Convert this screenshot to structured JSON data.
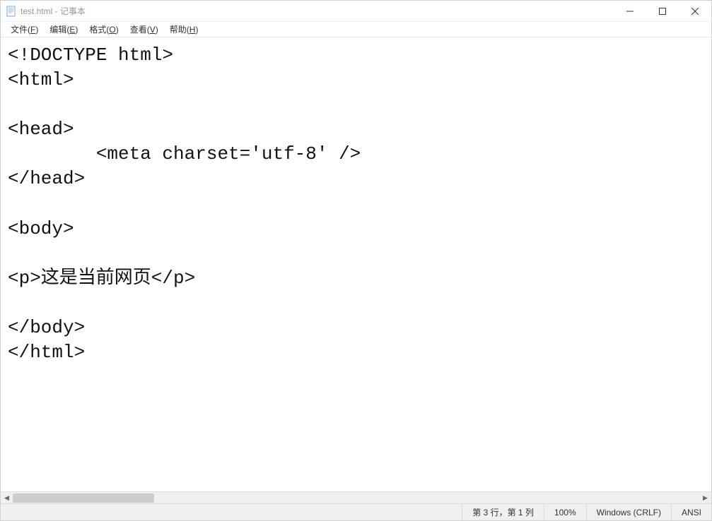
{
  "title": "test.html - 记事本",
  "menu": {
    "file": {
      "label": "文件",
      "accel": "F"
    },
    "edit": {
      "label": "编辑",
      "accel": "E"
    },
    "format": {
      "label": "格式",
      "accel": "O"
    },
    "view": {
      "label": "查看",
      "accel": "V"
    },
    "help": {
      "label": "帮助",
      "accel": "H"
    }
  },
  "content": "<!DOCTYPE html>\n<html>\n\n<head>\n        <meta charset='utf-8' />\n</head>\n\n<body>\n\n<p>这是当前网页</p>\n\n</body>\n</html>",
  "status": {
    "cursor": "第 3 行，第 1 列",
    "zoom": "100%",
    "line_ending": "Windows (CRLF)",
    "encoding": "ANSI"
  }
}
